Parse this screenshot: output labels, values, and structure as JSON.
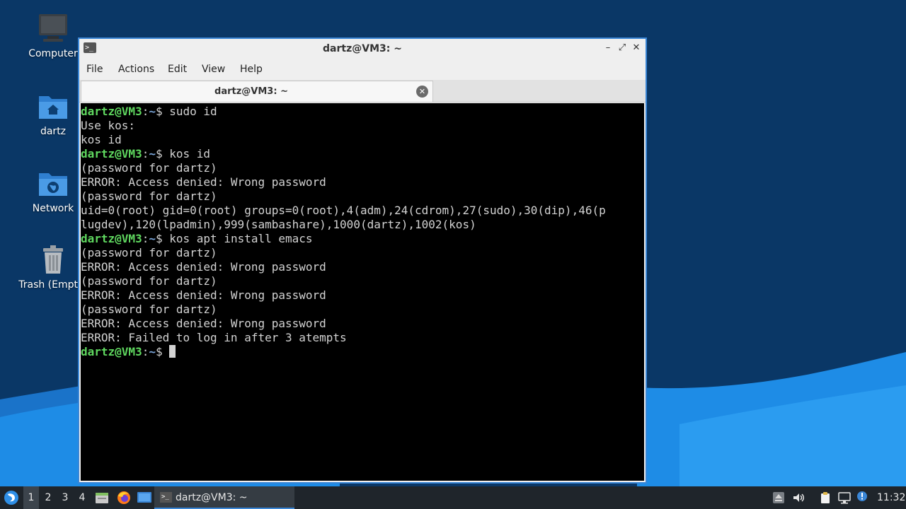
{
  "desktop": {
    "icons": [
      {
        "label": "Computer",
        "icon": "computer-icon"
      },
      {
        "label": "dartz",
        "icon": "home-folder-icon"
      },
      {
        "label": "Network",
        "icon": "network-folder-icon"
      },
      {
        "label": "Trash (Empty)",
        "icon": "trash-icon"
      }
    ]
  },
  "window": {
    "title": "dartz@VM3: ~",
    "buttons": {
      "minimize": "–",
      "maximize": "⤢",
      "close": "✕"
    },
    "menu": [
      "File",
      "Actions",
      "Edit",
      "View",
      "Help"
    ],
    "tab": {
      "title": "dartz@VM3: ~",
      "close": "✕"
    }
  },
  "terminal": {
    "prompt": {
      "user_host": "dartz@VM3",
      "sep": ":",
      "path": "~",
      "symbol": "$ "
    },
    "lines": [
      {
        "type": "prompt",
        "text": "sudo id"
      },
      {
        "type": "output",
        "text": "Use kos:"
      },
      {
        "type": "output",
        "text": "kos id"
      },
      {
        "type": "prompt",
        "text": "kos id"
      },
      {
        "type": "output",
        "text": "(password for dartz)"
      },
      {
        "type": "output",
        "text": "ERROR: Access denied: Wrong password"
      },
      {
        "type": "output",
        "text": "(password for dartz)"
      },
      {
        "type": "output",
        "text": "uid=0(root) gid=0(root) groups=0(root),4(adm),24(cdrom),27(sudo),30(dip),46(p"
      },
      {
        "type": "output",
        "text": "lugdev),120(lpadmin),999(sambashare),1000(dartz),1002(kos)"
      },
      {
        "type": "prompt",
        "text": "kos apt install emacs"
      },
      {
        "type": "output",
        "text": "(password for dartz)"
      },
      {
        "type": "output",
        "text": "ERROR: Access denied: Wrong password"
      },
      {
        "type": "output",
        "text": "(password for dartz)"
      },
      {
        "type": "output",
        "text": "ERROR: Access denied: Wrong password"
      },
      {
        "type": "output",
        "text": "(password for dartz)"
      },
      {
        "type": "output",
        "text": "ERROR: Access denied: Wrong password"
      },
      {
        "type": "output",
        "text": "ERROR: Failed to log in after 3 atempts"
      },
      {
        "type": "prompt",
        "text": "",
        "cursor": true
      }
    ]
  },
  "taskbar": {
    "workspaces": [
      "1",
      "2",
      "3",
      "4"
    ],
    "active_workspace": "1",
    "launchers": [
      "file-manager-icon",
      "firefox-icon",
      "show-desktop-icon"
    ],
    "window_label": "dartz@VM3: ~",
    "tray": [
      "eject-icon",
      "volume-icon",
      "clipboard-icon",
      "network-icon",
      "notification-icon"
    ],
    "clock": "11:32"
  },
  "colors": {
    "window_border": "#3a86d6",
    "prompt_user": "#5fd75f",
    "prompt_path": "#7aa6da",
    "terminal_bg": "#000000",
    "taskbar_bg": "#1f252b"
  }
}
